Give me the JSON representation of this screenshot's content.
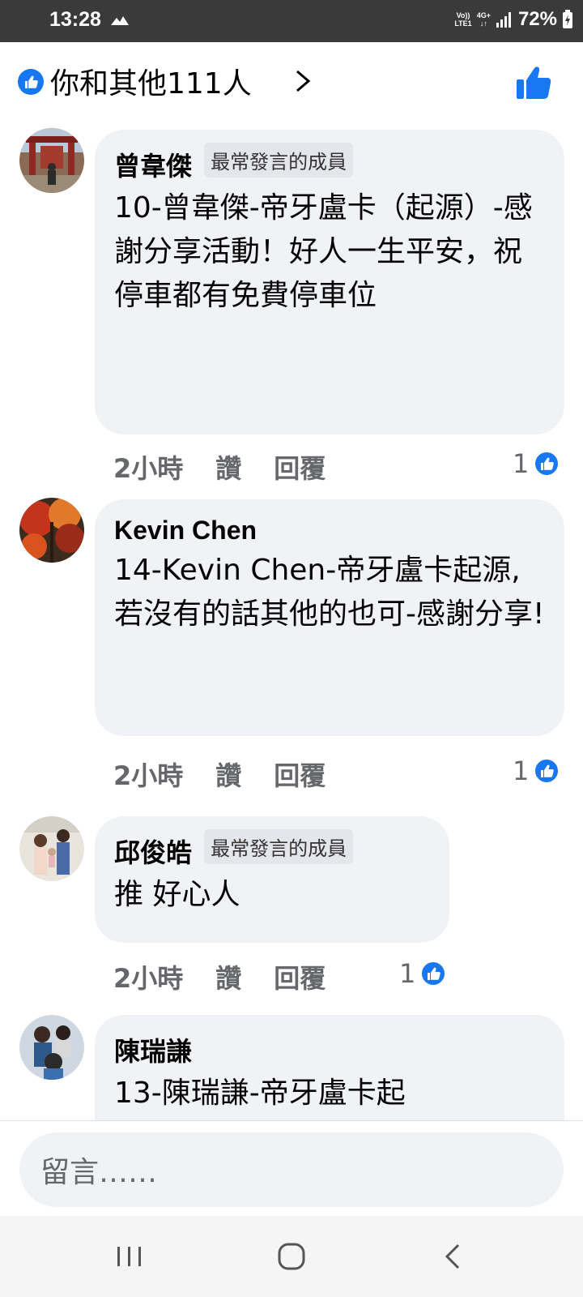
{
  "status": {
    "time": "13:28",
    "volte_top": "Vo))",
    "volte_bottom": "LTE1",
    "network": "4G+",
    "battery": "72%"
  },
  "reactions": {
    "summary": "你和其他111人"
  },
  "comments": [
    {
      "author": "曾韋傑",
      "badge": "最常發言的成員",
      "body": "10-曾韋傑-帝牙盧卡（起源）-感謝分享活動！好人一生平安，祝停車都有免費停車位",
      "time": "2小時",
      "like": "讚",
      "reply": "回覆",
      "likes": "1"
    },
    {
      "author": "Kevin Chen",
      "badge": "",
      "body": "14-Kevin Chen-帝牙盧卡起源,若沒有的話其他的也可-感謝分享!",
      "time": "2小時",
      "like": "讚",
      "reply": "回覆",
      "likes": "1"
    },
    {
      "author": "邱俊皓",
      "badge": "最常發言的成員",
      "body": "推 好心人",
      "time": "2小時",
      "like": "讚",
      "reply": "回覆",
      "likes": "1"
    },
    {
      "author": "陳瑞謙",
      "badge": "",
      "body": "13-陳瑞謙-帝牙盧卡起",
      "time": "",
      "like": "",
      "reply": "",
      "likes": ""
    }
  ],
  "composer": {
    "placeholder": "留言……"
  },
  "colors": {
    "facebook_blue": "#1877f2",
    "bubble_bg": "#f0f2f5",
    "meta_text": "#65676b"
  }
}
